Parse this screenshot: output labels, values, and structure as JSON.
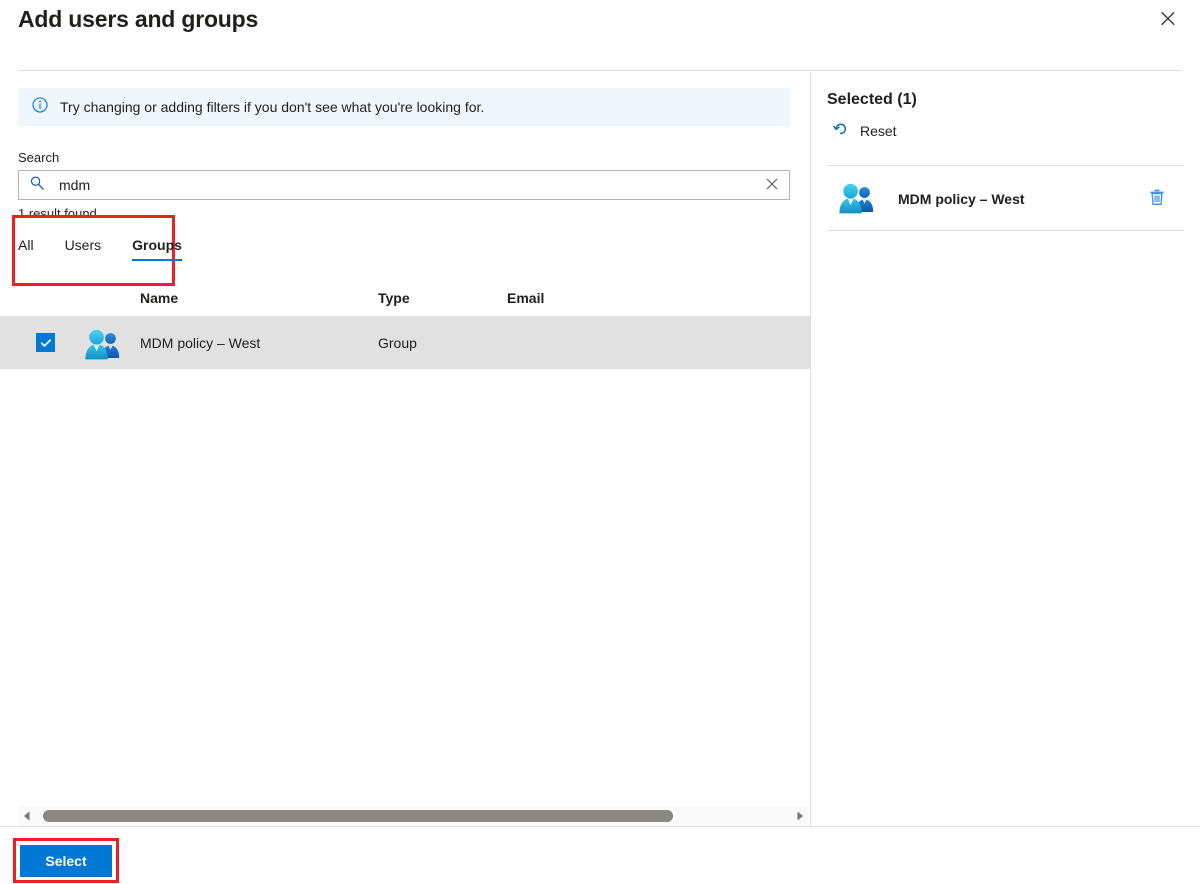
{
  "dialog": {
    "title": "Add users and groups",
    "close_icon": "close-icon"
  },
  "info_bar": {
    "icon": "info-circle-icon",
    "message": "Try changing or adding filters if you don't see what you're looking for."
  },
  "search": {
    "label": "Search",
    "value": "mdm",
    "placeholder": "",
    "search_icon": "magnifier-icon",
    "clear_icon": "clear-x-icon",
    "result_count": "1 result found"
  },
  "tabs": [
    {
      "label": "All",
      "active": false
    },
    {
      "label": "Users",
      "active": false
    },
    {
      "label": "Groups",
      "active": true
    }
  ],
  "table": {
    "columns": [
      "Name",
      "Type",
      "Email"
    ],
    "rows": [
      {
        "checked": true,
        "icon": "group-people-icon",
        "name": "MDM policy – West",
        "type": "Group",
        "email": ""
      }
    ]
  },
  "scrollbar": {
    "left_arrow_icon": "caret-left-icon",
    "right_arrow_icon": "caret-right-icon"
  },
  "selected_panel": {
    "title": "Selected (1)",
    "reset_label": "Reset",
    "reset_icon": "undo-arrow-icon",
    "items": [
      {
        "icon": "group-people-icon",
        "label": "MDM policy – West",
        "delete_icon": "trash-icon"
      }
    ]
  },
  "footer": {
    "select_label": "Select"
  },
  "colors": {
    "accent": "#0078d4",
    "annotation": "#ec2024",
    "info_bar_bg": "#eff6fc",
    "row_selected_bg": "#e1e1e1",
    "divider": "#e1dfdd",
    "scroll_thumb": "#8a8886"
  }
}
